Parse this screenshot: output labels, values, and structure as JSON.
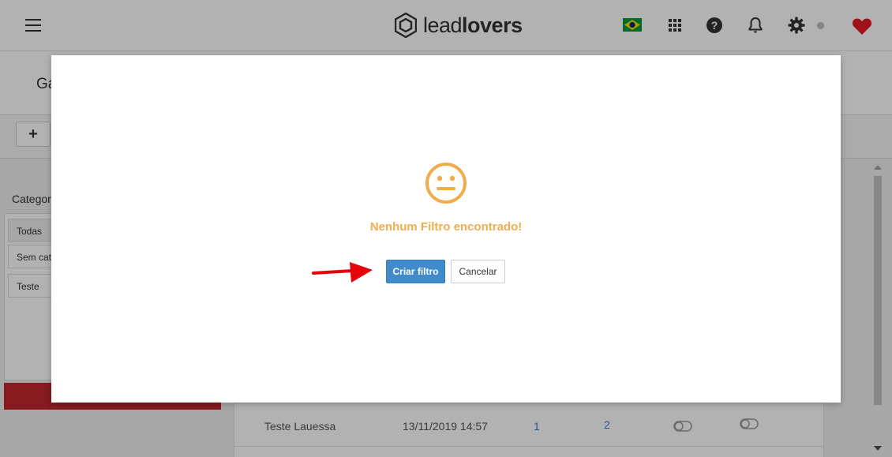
{
  "app": {
    "logo_lead": "lead",
    "logo_lovers": "lovers"
  },
  "header": {
    "page_title": "Ga"
  },
  "toolbar": {
    "add_label": "+"
  },
  "sidebar": {
    "title": "Categor",
    "items": [
      {
        "label": "Todas"
      },
      {
        "label": "Sem cat"
      },
      {
        "label": "Teste"
      }
    ]
  },
  "table": {
    "row": {
      "name": "Teste Lauessa",
      "date": "13/11/2019 14:57",
      "count1": "1",
      "count2": "2"
    }
  },
  "modal": {
    "message": "Nenhum Filtro encontrado!",
    "primary_label": "Criar filtro",
    "cancel_label": "Cancelar"
  },
  "colors": {
    "warning": "#f0ad4e",
    "primary": "#428bca",
    "arrow": "#e8000b"
  }
}
